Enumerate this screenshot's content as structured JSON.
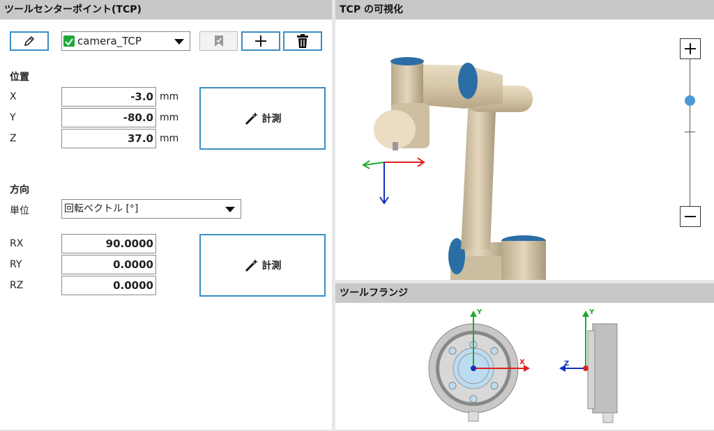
{
  "tool_panel": {
    "title": "ツールセンターポイント(TCP)",
    "tcp_selector": {
      "selected": "camera_TCP"
    },
    "position": {
      "heading": "位置",
      "fields": [
        {
          "axis": "X",
          "value": "-3.0",
          "unit": "mm"
        },
        {
          "axis": "Y",
          "value": "-80.0",
          "unit": "mm"
        },
        {
          "axis": "Z",
          "value": "37.0",
          "unit": "mm"
        }
      ],
      "measure_label": "計測"
    },
    "orientation": {
      "heading": "方向",
      "unit_label": "単位",
      "unit_selected": "回転ベクトル [°]",
      "fields": [
        {
          "axis": "RX",
          "value": "90.0000"
        },
        {
          "axis": "RY",
          "value": "0.0000"
        },
        {
          "axis": "RZ",
          "value": "0.0000"
        }
      ],
      "measure_label": "計測"
    }
  },
  "tcp_view": {
    "title": "TCP の可視化",
    "zoom_level": 0.72
  },
  "flange_view": {
    "title": "ツールフランジ",
    "front_axes": {
      "x": "X",
      "y": "Y"
    },
    "side_axes": {
      "z": "Z",
      "y": "Y"
    }
  },
  "colors": {
    "accent": "#3b8dc4",
    "check": "#1fa83a",
    "x_axis": "#e02020",
    "y_axis": "#1fa830",
    "z_axis": "#1030c0"
  }
}
